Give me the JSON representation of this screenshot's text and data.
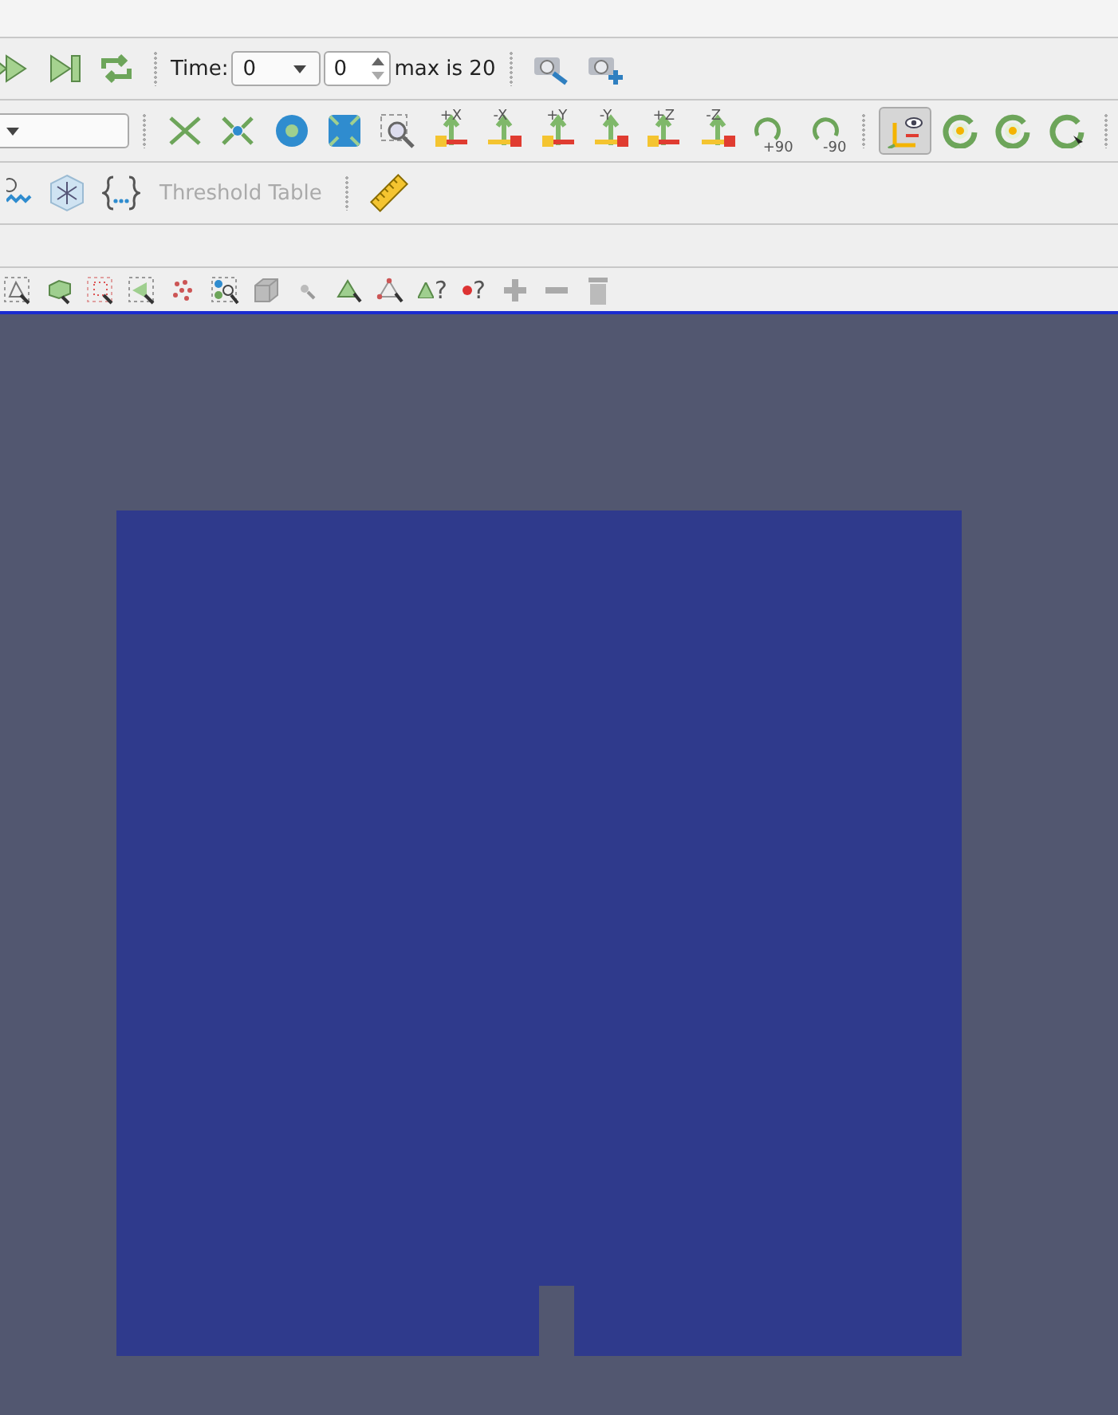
{
  "playback": {
    "time_label": "Time:",
    "time_value": "0",
    "index_value": "0",
    "max_label": "max is 20"
  },
  "camera_tools": [
    {
      "kind": "reset",
      "selected": false
    },
    {
      "kind": "zoom_closest",
      "selected": false
    },
    {
      "kind": "zoom_data",
      "selected": false
    },
    {
      "kind": "zoom_box",
      "selected": false
    },
    {
      "kind": "zoom_selection",
      "selected": false
    },
    {
      "kind": "axis",
      "label": "+X",
      "selected": false
    },
    {
      "kind": "axis",
      "label": "-X",
      "selected": false
    },
    {
      "kind": "axis",
      "label": "+Y",
      "selected": false
    },
    {
      "kind": "axis",
      "label": "-Y",
      "selected": false
    },
    {
      "kind": "axis",
      "label": "+Z",
      "selected": false
    },
    {
      "kind": "axis",
      "label": "-Z",
      "selected": false
    },
    {
      "kind": "rotate",
      "label": "+90",
      "selected": false
    },
    {
      "kind": "rotate",
      "label": "-90",
      "selected": false
    },
    {
      "kind": "interaction_mode",
      "selected": true
    },
    {
      "kind": "center",
      "selected": false
    },
    {
      "kind": "center",
      "selected": false
    },
    {
      "kind": "center_pick",
      "selected": false
    }
  ],
  "threshold_table": {
    "label": "Threshold Table",
    "disabled": true
  },
  "query_tools": [
    {
      "label": "?"
    },
    {
      "label": "?"
    }
  ]
}
